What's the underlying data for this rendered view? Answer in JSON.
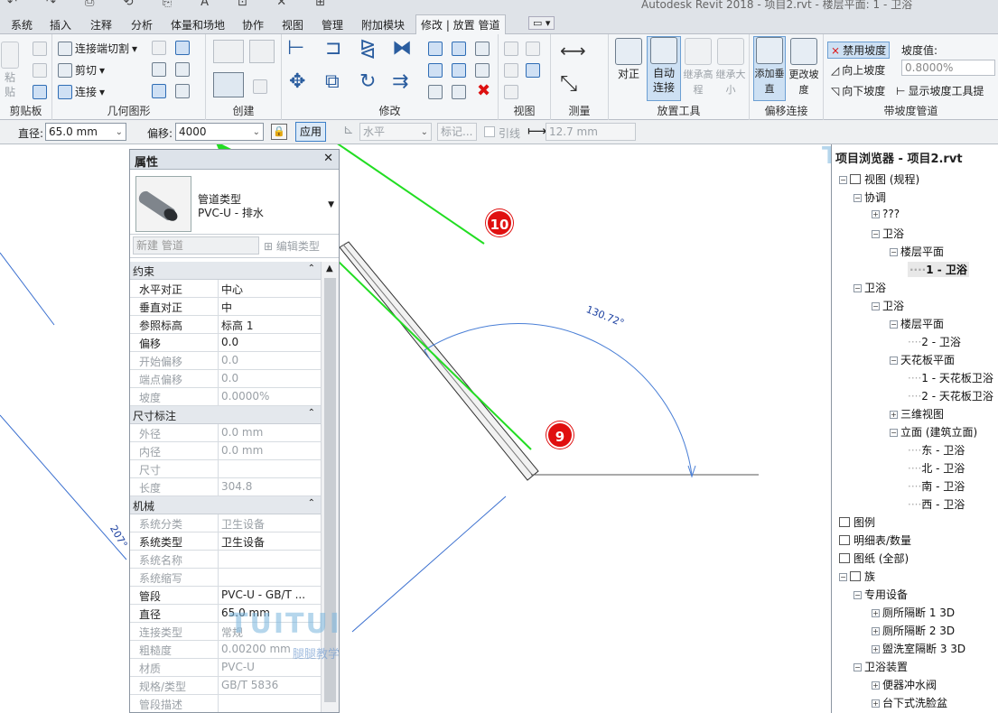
{
  "window": {
    "title": "Autodesk Revit 2018 -    项目2.rvt - 楼层平面: 1 - 卫浴"
  },
  "ribbon_tabs": [
    "系统",
    "插入",
    "注释",
    "分析",
    "体量和场地",
    "协作",
    "视图",
    "管理",
    "附加模块",
    "修改 | 放置 管道"
  ],
  "ribbon": {
    "clipboard": {
      "label": "剪贴板",
      "paste": "粘贴"
    },
    "geometry": {
      "label": "几何图形",
      "items": [
        "连接端切割",
        "剪切",
        "连接"
      ]
    },
    "create": {
      "label": "创建"
    },
    "modify": {
      "label": "修改"
    },
    "view": {
      "label": "视图"
    },
    "measure": {
      "label": "测量"
    },
    "placement_tools": {
      "label": "放置工具",
      "items": [
        "对正",
        "自动连接",
        "继承高程",
        "继承大小"
      ],
      "auto_connect": "自动\n连接"
    },
    "offset_connect": {
      "label": "偏移连接",
      "items": [
        "添加垂直",
        "更改坡度"
      ]
    },
    "sloped_pipe": {
      "label": "带坡度管道",
      "disable_slope": "禁用坡度",
      "slope_up": "向上坡度",
      "slope_down": "向下坡度",
      "slope_value_label": "坡度值:",
      "slope_value": "0.8000%",
      "show_slope_tooltip": "显示坡度工具提"
    }
  },
  "options_bar": {
    "diameter_label": "直径:",
    "diameter_value": "65.0 mm",
    "offset_label": "偏移:",
    "offset_value": "4000",
    "apply_button": "应用",
    "horizontal_value": "水平",
    "tag_placeholder": "标记...",
    "leader_label": "引线",
    "leader_length": "12.7 mm"
  },
  "properties": {
    "title": "属性",
    "type_family": "管道类型",
    "type_name": "PVC-U - 排水",
    "instance_selector": "新建 管道",
    "edit_type": "编辑类型",
    "groups": [
      {
        "name": "约束",
        "rows": [
          {
            "k": "水平对正",
            "v": "中心",
            "dim": false
          },
          {
            "k": "垂直对正",
            "v": "中",
            "dim": false
          },
          {
            "k": "参照标高",
            "v": "标高 1",
            "dim": false
          },
          {
            "k": "偏移",
            "v": "0.0",
            "dim": false
          },
          {
            "k": "开始偏移",
            "v": "0.0",
            "dim": true
          },
          {
            "k": "端点偏移",
            "v": "0.0",
            "dim": true
          },
          {
            "k": "坡度",
            "v": "0.0000%",
            "dim": true
          }
        ]
      },
      {
        "name": "尺寸标注",
        "rows": [
          {
            "k": "外径",
            "v": "0.0 mm",
            "dim": true
          },
          {
            "k": "内径",
            "v": "0.0 mm",
            "dim": true
          },
          {
            "k": "尺寸",
            "v": "",
            "dim": true
          },
          {
            "k": "长度",
            "v": "304.8",
            "dim": true
          }
        ]
      },
      {
        "name": "机械",
        "rows": [
          {
            "k": "系统分类",
            "v": "卫生设备",
            "dim": true
          },
          {
            "k": "系统类型",
            "v": "卫生设备",
            "dim": false
          },
          {
            "k": "系统名称",
            "v": "",
            "dim": true
          },
          {
            "k": "系统缩写",
            "v": "",
            "dim": true
          },
          {
            "k": "管段",
            "v": "PVC-U - GB/T ...",
            "dim": false
          },
          {
            "k": "直径",
            "v": "65.0 mm",
            "dim": false
          },
          {
            "k": "连接类型",
            "v": "常规",
            "dim": true
          },
          {
            "k": "粗糙度",
            "v": "0.00200 mm",
            "dim": true
          },
          {
            "k": "材质",
            "v": "PVC-U",
            "dim": true
          },
          {
            "k": "规格/类型",
            "v": "GB/T 5836",
            "dim": true
          },
          {
            "k": "管段描述",
            "v": "",
            "dim": true
          }
        ]
      }
    ]
  },
  "browser": {
    "title": "项目浏览器 - 项目2.rvt",
    "nodes": [
      {
        "label": "视图 (规程)",
        "level": 0,
        "ex": "−",
        "icon": true
      },
      {
        "label": "协调",
        "level": 1,
        "ex": "−"
      },
      {
        "label": "???",
        "level": 2,
        "ex": "+"
      },
      {
        "label": "卫浴",
        "level": 2,
        "ex": "−"
      },
      {
        "label": "楼层平面",
        "level": 3,
        "ex": "−"
      },
      {
        "label": "1 - 卫浴",
        "level": 4,
        "sel": true
      },
      {
        "label": "卫浴",
        "level": 1,
        "ex": "−"
      },
      {
        "label": "卫浴",
        "level": 2,
        "ex": "−"
      },
      {
        "label": "楼层平面",
        "level": 3,
        "ex": "−"
      },
      {
        "label": "2 - 卫浴",
        "level": 4
      },
      {
        "label": "天花板平面",
        "level": 3,
        "ex": "−"
      },
      {
        "label": "1 - 天花板卫浴",
        "level": 4
      },
      {
        "label": "2 - 天花板卫浴",
        "level": 4
      },
      {
        "label": "三维视图",
        "level": 3,
        "ex": "+"
      },
      {
        "label": "立面 (建筑立面)",
        "level": 3,
        "ex": "−"
      },
      {
        "label": "东 - 卫浴",
        "level": 4
      },
      {
        "label": "北 - 卫浴",
        "level": 4
      },
      {
        "label": "南 - 卫浴",
        "level": 4
      },
      {
        "label": "西 - 卫浴",
        "level": 4
      },
      {
        "label": "图例",
        "level": 0,
        "icon": true
      },
      {
        "label": "明细表/数量",
        "level": 0,
        "icon": true
      },
      {
        "label": "图纸 (全部)",
        "level": 0,
        "icon": true
      },
      {
        "label": "族",
        "level": 0,
        "ex": "−",
        "icon": true
      },
      {
        "label": "专用设备",
        "level": 1,
        "ex": "−"
      },
      {
        "label": "厕所隔断 1 3D",
        "level": 2,
        "ex": "+"
      },
      {
        "label": "厕所隔断 2 3D",
        "level": 2,
        "ex": "+"
      },
      {
        "label": "盥洗室隔断 3 3D",
        "level": 2,
        "ex": "+"
      },
      {
        "label": "卫浴装置",
        "level": 1,
        "ex": "−"
      },
      {
        "label": "便器冲水阀",
        "level": 2,
        "ex": "+"
      },
      {
        "label": "台下式洗脸盆",
        "level": 2,
        "ex": "+"
      }
    ]
  },
  "canvas": {
    "angle_label": "130.72°",
    "side_angle_label": "207°",
    "callouts": [
      "10",
      "9"
    ],
    "annotation_color": "#22dd22",
    "callout_color": "#e01010"
  },
  "watermark": {
    "text": "TUITUISOFT",
    "sub": "腿腿教学网"
  }
}
